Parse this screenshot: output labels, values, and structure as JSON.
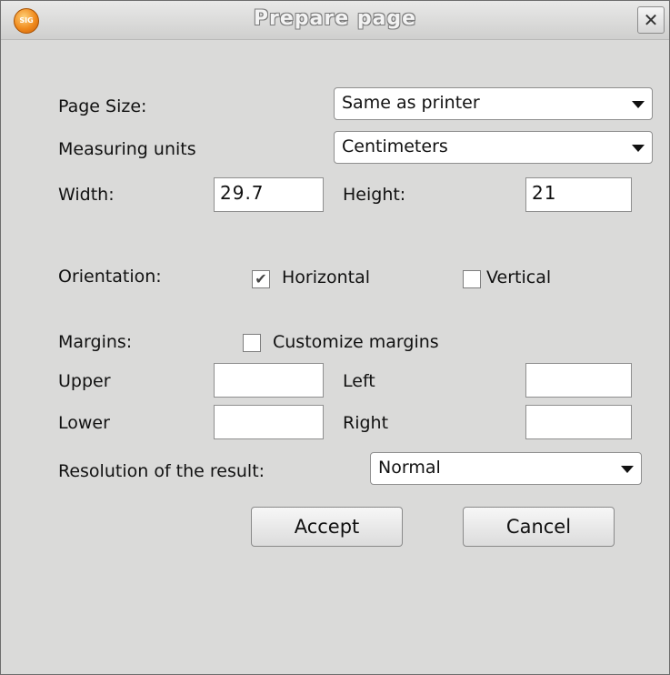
{
  "window": {
    "title": "Prepare page",
    "app_icon": "sig-logo-icon",
    "close_icon": "✕"
  },
  "page_size": {
    "label": "Page Size:",
    "value": "Same as printer"
  },
  "units": {
    "label": "Measuring units",
    "value": "Centimeters"
  },
  "width": {
    "label": "Width:",
    "value": "29.7"
  },
  "height": {
    "label": "Height:",
    "value": "21"
  },
  "orientation": {
    "label": "Orientation:",
    "horizontal": {
      "label": "Horizontal",
      "checked": true,
      "mark": "✔"
    },
    "vertical": {
      "label": "Vertical",
      "checked": false
    }
  },
  "margins": {
    "label": "Margins:",
    "customize_label": "Customize margins",
    "customize_checked": false,
    "upper_label": "Upper",
    "left_label": "Left",
    "lower_label": "Lower",
    "right_label": "Right",
    "upper_value": "",
    "left_value": "",
    "lower_value": "",
    "right_value": ""
  },
  "resolution": {
    "label": "Resolution of the result:",
    "value": "Normal"
  },
  "buttons": {
    "accept": "Accept",
    "cancel": "Cancel"
  }
}
